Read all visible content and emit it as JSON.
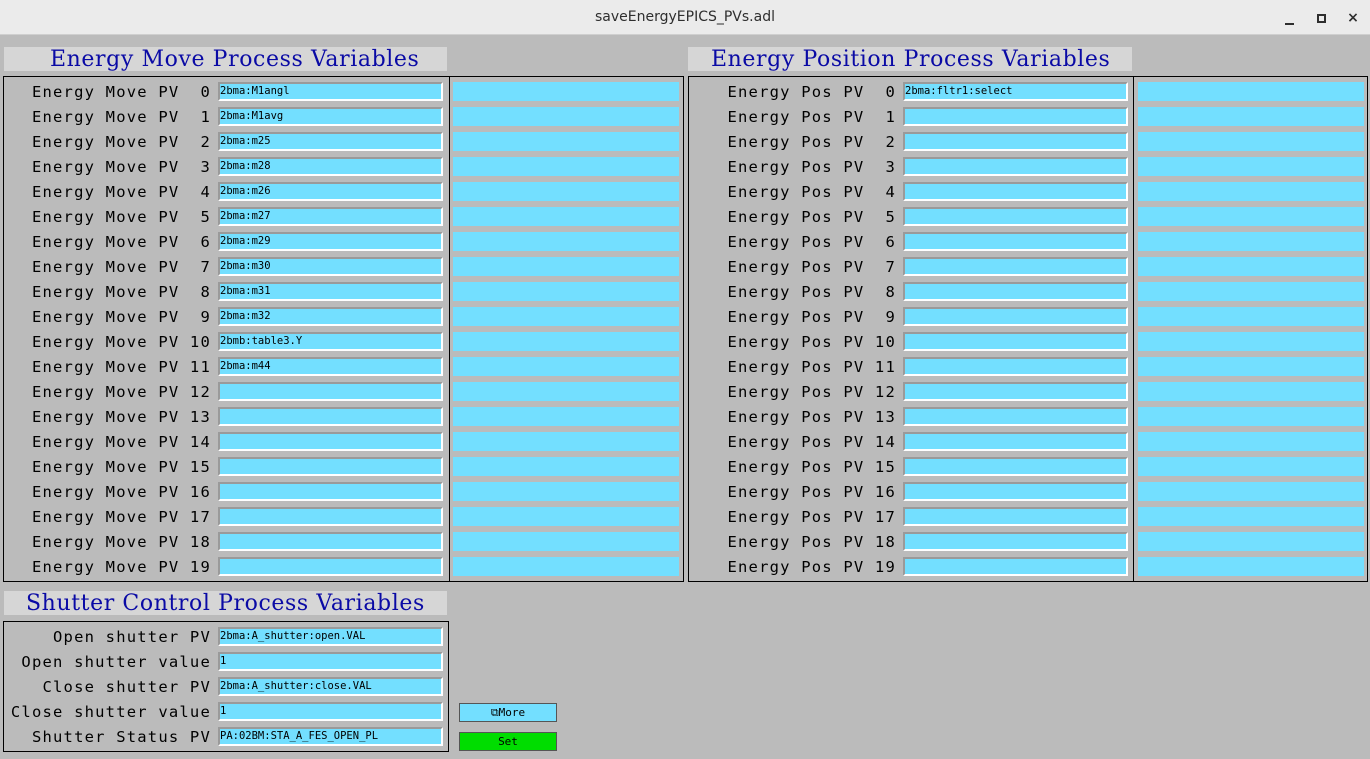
{
  "window": {
    "title": "saveEnergyEPICS_PVs.adl",
    "minimize_glyph": "minimize-icon",
    "maximize_glyph": "maximize-icon",
    "close_glyph": "×"
  },
  "energy_move": {
    "heading": "Energy Move Process Variables",
    "rows": [
      {
        "label": "Energy Move PV  0",
        "value": "2bma:M1angl"
      },
      {
        "label": "Energy Move PV  1",
        "value": "2bma:M1avg"
      },
      {
        "label": "Energy Move PV  2",
        "value": "2bma:m25"
      },
      {
        "label": "Energy Move PV  3",
        "value": "2bma:m28"
      },
      {
        "label": "Energy Move PV  4",
        "value": "2bma:m26"
      },
      {
        "label": "Energy Move PV  5",
        "value": "2bma:m27"
      },
      {
        "label": "Energy Move PV  6",
        "value": "2bma:m29"
      },
      {
        "label": "Energy Move PV  7",
        "value": "2bma:m30"
      },
      {
        "label": "Energy Move PV  8",
        "value": "2bma:m31"
      },
      {
        "label": "Energy Move PV  9",
        "value": "2bma:m32"
      },
      {
        "label": "Energy Move PV 10",
        "value": "2bmb:table3.Y"
      },
      {
        "label": "Energy Move PV 11",
        "value": "2bma:m44"
      },
      {
        "label": "Energy Move PV 12",
        "value": ""
      },
      {
        "label": "Energy Move PV 13",
        "value": ""
      },
      {
        "label": "Energy Move PV 14",
        "value": ""
      },
      {
        "label": "Energy Move PV 15",
        "value": ""
      },
      {
        "label": "Energy Move PV 16",
        "value": ""
      },
      {
        "label": "Energy Move PV 17",
        "value": ""
      },
      {
        "label": "Energy Move PV 18",
        "value": ""
      },
      {
        "label": "Energy Move PV 19",
        "value": ""
      }
    ]
  },
  "energy_pos": {
    "heading": "Energy Position Process Variables",
    "rows": [
      {
        "label": "Energy Pos PV  0",
        "value": "2bma:fltr1:select"
      },
      {
        "label": "Energy Pos PV  1",
        "value": ""
      },
      {
        "label": "Energy Pos PV  2",
        "value": ""
      },
      {
        "label": "Energy Pos PV  3",
        "value": ""
      },
      {
        "label": "Energy Pos PV  4",
        "value": ""
      },
      {
        "label": "Energy Pos PV  5",
        "value": ""
      },
      {
        "label": "Energy Pos PV  6",
        "value": ""
      },
      {
        "label": "Energy Pos PV  7",
        "value": ""
      },
      {
        "label": "Energy Pos PV  8",
        "value": ""
      },
      {
        "label": "Energy Pos PV  9",
        "value": ""
      },
      {
        "label": "Energy Pos PV 10",
        "value": ""
      },
      {
        "label": "Energy Pos PV 11",
        "value": ""
      },
      {
        "label": "Energy Pos PV 12",
        "value": ""
      },
      {
        "label": "Energy Pos PV 13",
        "value": ""
      },
      {
        "label": "Energy Pos PV 14",
        "value": ""
      },
      {
        "label": "Energy Pos PV 15",
        "value": ""
      },
      {
        "label": "Energy Pos PV 16",
        "value": ""
      },
      {
        "label": "Energy Pos PV 17",
        "value": ""
      },
      {
        "label": "Energy Pos PV 18",
        "value": ""
      },
      {
        "label": "Energy Pos PV 19",
        "value": ""
      }
    ]
  },
  "shutter": {
    "heading": "Shutter Control Process Variables",
    "rows": [
      {
        "label": "Open shutter PV",
        "value": "2bma:A_shutter:open.VAL"
      },
      {
        "label": "Open shutter value",
        "value": "1"
      },
      {
        "label": "Close shutter PV",
        "value": "2bma:A_shutter:close.VAL"
      },
      {
        "label": "Close shutter value",
        "value": "1"
      },
      {
        "label": "Shutter Status PV",
        "value": "PA:02BM:STA_A_FES_OPEN_PL"
      }
    ],
    "more_button": "⧉More",
    "set_button": "Set"
  },
  "colors": {
    "field": "#73dfff",
    "background": "#bbbbbb",
    "heading_text": "#0a0aa5",
    "set_button": "#00dd00"
  }
}
